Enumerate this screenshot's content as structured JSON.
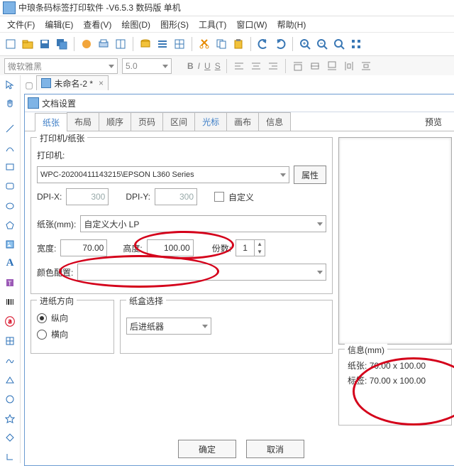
{
  "app_title": "中琅条码标签打印软件 -V6.5.3 数码版 单机",
  "menus": [
    "文件(F)",
    "编辑(E)",
    "查看(V)",
    "绘图(D)",
    "图形(S)",
    "工具(T)",
    "窗口(W)",
    "帮助(H)"
  ],
  "format_bar": {
    "font_placeholder": "微软雅黑",
    "size_placeholder": "5.0",
    "b": "B",
    "i": "I",
    "u": "U",
    "s": "S"
  },
  "doc_tab": "未命名-2 *",
  "dialog": {
    "title": "文档设置",
    "tabs": [
      "纸张",
      "布局",
      "顺序",
      "页码",
      "区间",
      "光标",
      "画布",
      "信息"
    ],
    "active_tab": 0,
    "preview_label": "预览",
    "group1": {
      "legend": "打印机/纸张",
      "printer_label": "打印机:",
      "printer_value": "WPC-20200411143215\\EPSON L360 Series",
      "props_btn": "属性",
      "dpi_x_label": "DPI-X:",
      "dpi_x": "300",
      "dpi_y_label": "DPI-Y:",
      "dpi_y": "300",
      "custom_chk": "自定义",
      "paper_label": "纸张(mm):",
      "paper_value": "自定义大小 LP",
      "width_label": "宽度:",
      "width": "70.00",
      "height_label": "高度:",
      "height": "100.00",
      "copies_label": "份数:",
      "copies": "1",
      "color_label": "颜色配置:",
      "color_value": ""
    },
    "group2": {
      "legend": "进纸方向",
      "opt1": "纵向",
      "opt2": "横向",
      "selected": "纵向"
    },
    "group3": {
      "legend": "纸盒选择",
      "tray": "后进纸器"
    },
    "info": {
      "legend": "信息(mm)",
      "paper_l": "纸张:",
      "paper_v": "70.00 x 100.00",
      "label_l": "标签:",
      "label_v": "70.00 x 100.00"
    },
    "ok": "确定",
    "cancel": "取消"
  },
  "icons": {
    "new": "#f2a53a",
    "open": "#f2c23a",
    "save": "#3a78b5",
    "saveall": "#3a78b5",
    "cut": "#e68a00",
    "copy": "#3a78b5",
    "paste": "#3a78b5",
    "undo": "#3a78b5",
    "redo": "#3a78b5",
    "zoomin": "#3a78b5",
    "zoomout": "#3a78b5",
    "grid": "#3a78b5"
  }
}
